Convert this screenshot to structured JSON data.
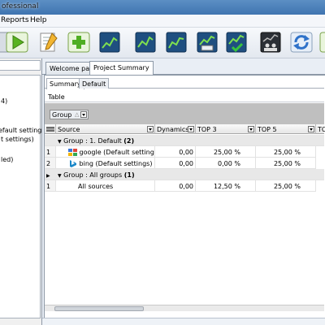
{
  "window": {
    "title": "ofessional"
  },
  "menu": {
    "items": [
      "Reports",
      "Help"
    ]
  },
  "toolbar": {
    "buttons": [
      {
        "icon": "play-icon"
      },
      {
        "icon": "edit-document-icon"
      },
      {
        "icon": "add-icon"
      },
      {
        "icon": "chart-icon"
      },
      {
        "icon": "chart-icon"
      },
      {
        "icon": "chart-icon"
      },
      {
        "icon": "chart-report-icon"
      },
      {
        "icon": "chart-check-icon"
      },
      {
        "icon": "chart-users-icon"
      },
      {
        "icon": "refresh-icon"
      }
    ]
  },
  "leftpanel": {
    "lines": [
      "4)",
      "efault settings)",
      "t settings)",
      "led)"
    ]
  },
  "tabs": [
    {
      "label": "Welcome page"
    },
    {
      "label": "Project Summary"
    }
  ],
  "subtabs": [
    {
      "label": "Summary"
    },
    {
      "label": "Default"
    }
  ],
  "section_label": "Table",
  "group_button": {
    "label": "Group",
    "sort_glyph": "△"
  },
  "columns": {
    "source": "Source",
    "dynamics": "Dynamics",
    "top3": "TOP 3",
    "top5": "TOP 5",
    "top10": "TO"
  },
  "groups": [
    {
      "label": "Group : 1. Default",
      "count": "(2)",
      "rows": [
        {
          "no": "1",
          "source": "google (Default settings)",
          "icon": "google-icon",
          "dynamics": "0,00",
          "top3": "25,00 %",
          "top5": "25,00 %"
        },
        {
          "no": "2",
          "source": "bing (Default settings)",
          "icon": "bing-icon",
          "dynamics": "0,00",
          "top3": "0,00 %",
          "top5": "25,00 %"
        }
      ]
    },
    {
      "label": "Group : All groups",
      "count": "(1)",
      "rows": [
        {
          "no": "1",
          "source": "All sources",
          "icon": "",
          "dynamics": "0,00",
          "top3": "12,50 %",
          "top5": "25,00 %"
        }
      ]
    }
  ]
}
